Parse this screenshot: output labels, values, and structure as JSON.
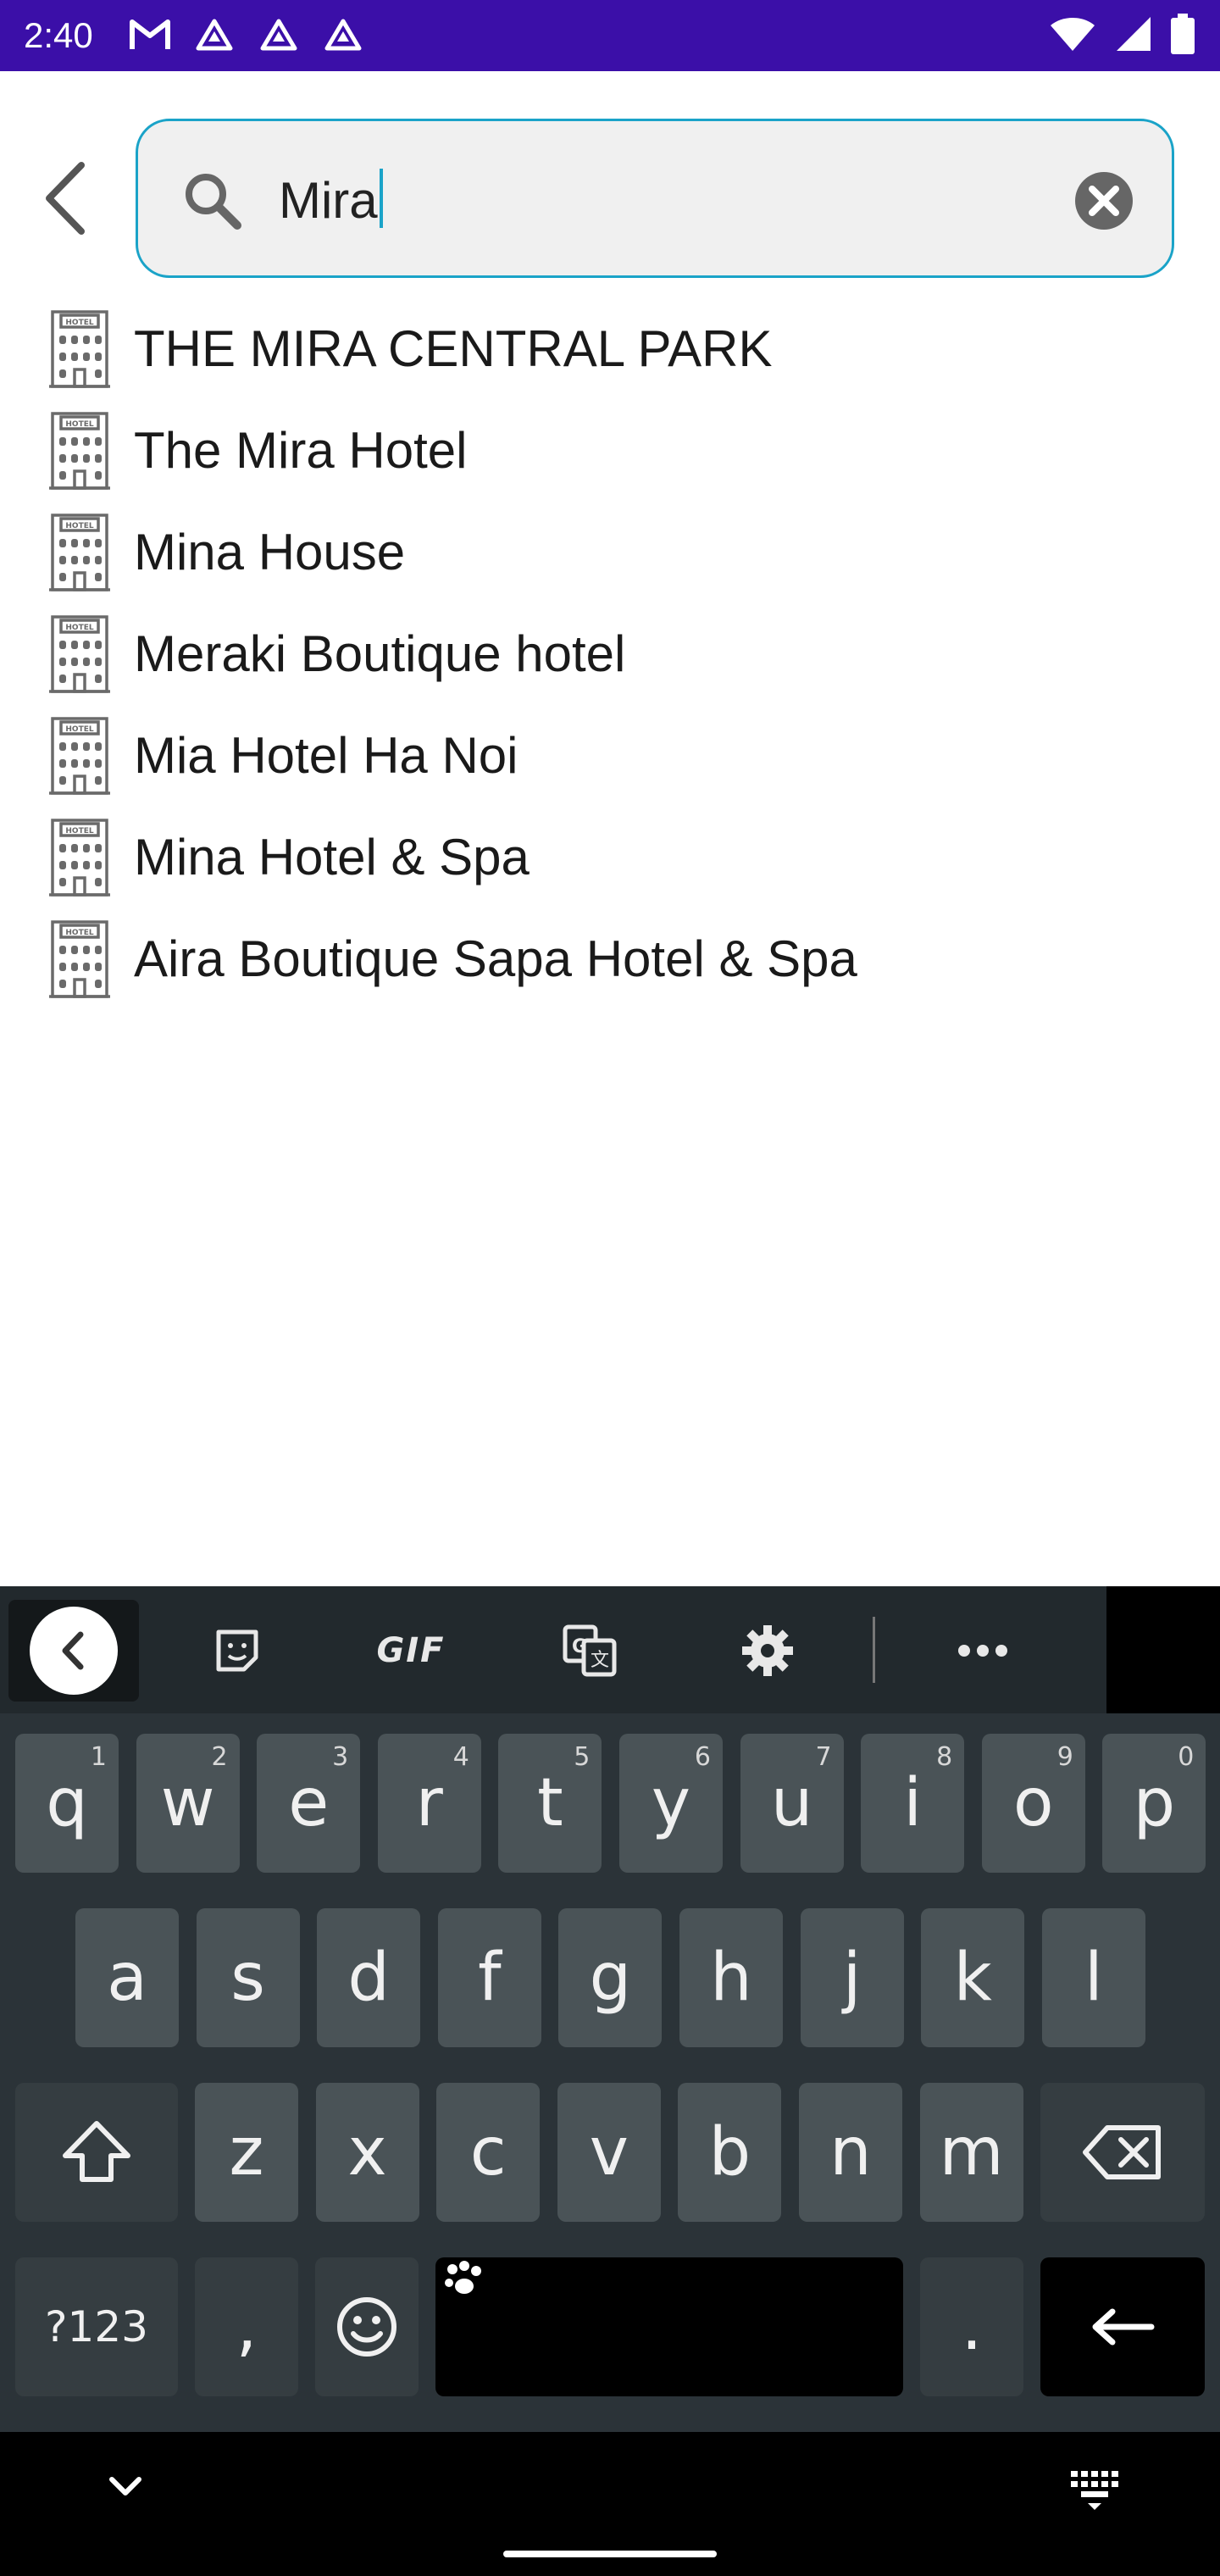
{
  "status_bar": {
    "time": "2:40",
    "left_icons": [
      "gmail-icon",
      "drive-icon",
      "drive-icon",
      "drive-icon"
    ],
    "right_icons": [
      "wifi-icon",
      "signal-icon",
      "battery-icon"
    ],
    "background": "#3b0fa8"
  },
  "search": {
    "query": "Mira",
    "accent": "#1aa3c8"
  },
  "results": [
    {
      "label": "THE MIRA CENTRAL PARK"
    },
    {
      "label": "The Mira Hotel"
    },
    {
      "label": "Mina House"
    },
    {
      "label": "Meraki Boutique hotel"
    },
    {
      "label": "Mia Hotel Ha Noi"
    },
    {
      "label": "Mina Hotel & Spa"
    },
    {
      "label": "Aira Boutique Sapa Hotel & Spa"
    }
  ],
  "keyboard": {
    "toolbar": {
      "gif_label": "GIF",
      "more_label": "•••"
    },
    "row1": [
      {
        "key": "q",
        "hint": "1"
      },
      {
        "key": "w",
        "hint": "2"
      },
      {
        "key": "e",
        "hint": "3"
      },
      {
        "key": "r",
        "hint": "4"
      },
      {
        "key": "t",
        "hint": "5"
      },
      {
        "key": "y",
        "hint": "6"
      },
      {
        "key": "u",
        "hint": "7"
      },
      {
        "key": "i",
        "hint": "8"
      },
      {
        "key": "o",
        "hint": "9"
      },
      {
        "key": "p",
        "hint": "0"
      }
    ],
    "row2": [
      "a",
      "s",
      "d",
      "f",
      "g",
      "h",
      "j",
      "k",
      "l"
    ],
    "row3": [
      "z",
      "x",
      "c",
      "v",
      "b",
      "n",
      "m"
    ],
    "sym_label": "?123",
    "comma_label": ",",
    "period_label": "."
  }
}
